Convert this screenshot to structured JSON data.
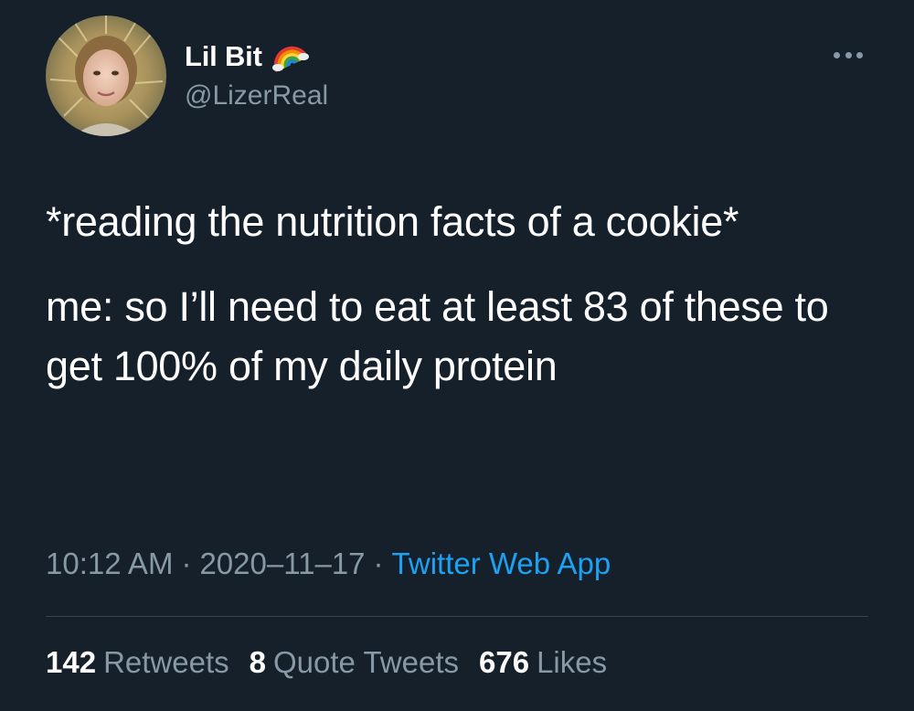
{
  "author": {
    "display_name": "Lil Bit",
    "badge_icon": "rainbow-icon",
    "handle": "@LizerReal",
    "avatar_icon": "avatar-photo"
  },
  "menu": {
    "icon": "more-horizontal-icon"
  },
  "tweet": {
    "paragraphs": [
      "*reading the nutrition facts of a cookie*",
      "me: so I’ll need to eat at least 83 of these to get 100% of my daily protein"
    ]
  },
  "meta": {
    "time": "10:12 AM",
    "separator": "·",
    "date": "2020–11–17",
    "source": "Twitter Web App"
  },
  "stats": {
    "retweets": {
      "count": "142",
      "label": "Retweets"
    },
    "quotes": {
      "count": "8",
      "label": "Quote Tweets"
    },
    "likes": {
      "count": "676",
      "label": "Likes"
    }
  },
  "colors": {
    "background": "#15202b",
    "primary_text": "#ffffff",
    "secondary_text": "#8899a6",
    "link": "#1da1f2",
    "divider": "#38444d"
  }
}
